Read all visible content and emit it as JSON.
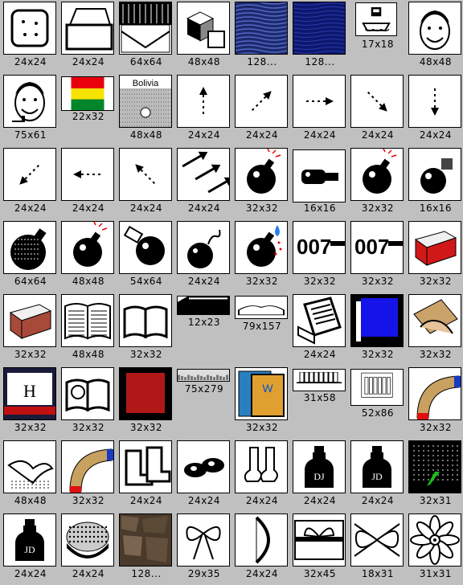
{
  "items": [
    {
      "label": "24x24",
      "icon": "clock-icon"
    },
    {
      "label": "24x24",
      "icon": "tray-icon"
    },
    {
      "label": "64x64",
      "icon": "envelope-icon"
    },
    {
      "label": "48x48",
      "icon": "boxes-icon"
    },
    {
      "label": "128...",
      "icon": "blue-texture-icon"
    },
    {
      "label": "128...",
      "icon": "dark-blue-texture-icon"
    },
    {
      "label": "17x18",
      "icon": "ship-icon"
    },
    {
      "label": "48x48",
      "icon": "smiling-man-icon"
    },
    {
      "label": "75x61",
      "icon": "smiling-man-pipe-icon"
    },
    {
      "label": "22x32",
      "icon": "bolivia-flag-icon"
    },
    {
      "label": "48x48",
      "icon": "bolivia-card-icon",
      "text": "Bolivia"
    },
    {
      "label": "24x24",
      "icon": "arrow-up-icon"
    },
    {
      "label": "24x24",
      "icon": "arrow-up-right-icon"
    },
    {
      "label": "24x24",
      "icon": "arrow-right-icon"
    },
    {
      "label": "24x24",
      "icon": "arrow-down-right-icon"
    },
    {
      "label": "24x24",
      "icon": "arrow-down-icon"
    },
    {
      "label": "24x24",
      "icon": "arrow-down-left-icon"
    },
    {
      "label": "24x24",
      "icon": "arrow-left-icon"
    },
    {
      "label": "24x24",
      "icon": "arrow-up-left-icon"
    },
    {
      "label": "24x24",
      "icon": "triple-arrows-icon"
    },
    {
      "label": "32x32",
      "icon": "bomb-icon"
    },
    {
      "label": "16x16",
      "icon": "bomb-side-icon"
    },
    {
      "label": "32x32",
      "icon": "bomb-icon"
    },
    {
      "label": "16x16",
      "icon": "bomb-small-icon"
    },
    {
      "label": "64x64",
      "icon": "bomb-dotted-icon"
    },
    {
      "label": "48x48",
      "icon": "bomb-icon"
    },
    {
      "label": "54x64",
      "icon": "bomb-tilted-icon"
    },
    {
      "label": "24x24",
      "icon": "bomb-fuse-icon"
    },
    {
      "label": "32x32",
      "icon": "bomb-drop-icon"
    },
    {
      "label": "32x32",
      "icon": "007-logo-icon",
      "text": "007"
    },
    {
      "label": "32x32",
      "icon": "007-logo-icon",
      "text": "007"
    },
    {
      "label": "32x32",
      "icon": "red-book-icon"
    },
    {
      "label": "32x32",
      "icon": "brown-book-icon"
    },
    {
      "label": "48x48",
      "icon": "open-book-icon"
    },
    {
      "label": "32x32",
      "icon": "open-book-outline-icon"
    },
    {
      "label": "12x23",
      "icon": "closed-book-icon"
    },
    {
      "label": "79x157",
      "icon": "open-book-wide-icon"
    },
    {
      "label": "24x24",
      "icon": "device-book-icon"
    },
    {
      "label": "32x32",
      "icon": "blue-book-icon"
    },
    {
      "label": "32x32",
      "icon": "handshake-icon"
    },
    {
      "label": "32x32",
      "icon": "encyclopedia-icon",
      "text": "H"
    },
    {
      "label": "32x32",
      "icon": "book-skull-icon"
    },
    {
      "label": "32x32",
      "icon": "red-square-book-icon"
    },
    {
      "label": "75x279",
      "icon": "bookshelf-strip-icon"
    },
    {
      "label": "32x32",
      "icon": "book-stack-icon"
    },
    {
      "label": "31x58",
      "icon": "bookshelf-icon"
    },
    {
      "label": "52x86",
      "icon": "shelf-books-icon"
    },
    {
      "label": "32x32",
      "icon": "boomerang-arc-icon"
    },
    {
      "label": "48x48",
      "icon": "boomerang-icon"
    },
    {
      "label": "32x32",
      "icon": "boomerang-arc-icon"
    },
    {
      "label": "24x24",
      "icon": "boots-icon"
    },
    {
      "label": "24x24",
      "icon": "shoes-icon"
    },
    {
      "label": "24x24",
      "icon": "socks-icon"
    },
    {
      "label": "24x24",
      "icon": "bottle-dj-icon",
      "text": "DJ"
    },
    {
      "label": "24x24",
      "icon": "bottle-jd-icon",
      "text": "JD"
    },
    {
      "label": "32x31",
      "icon": "dark-check-icon"
    },
    {
      "label": "24x24",
      "icon": "bottle-jd-icon",
      "text": "JD"
    },
    {
      "label": "24x24",
      "icon": "bowl-icon"
    },
    {
      "label": "128...",
      "icon": "stone-texture-icon"
    },
    {
      "label": "29x35",
      "icon": "bow-gift-icon"
    },
    {
      "label": "24x24",
      "icon": "archery-bow-icon"
    },
    {
      "label": "32x45",
      "icon": "gift-box-icon"
    },
    {
      "label": "18x31",
      "icon": "ribbon-bow-icon"
    },
    {
      "label": "31x31",
      "icon": "flower-icon"
    }
  ]
}
